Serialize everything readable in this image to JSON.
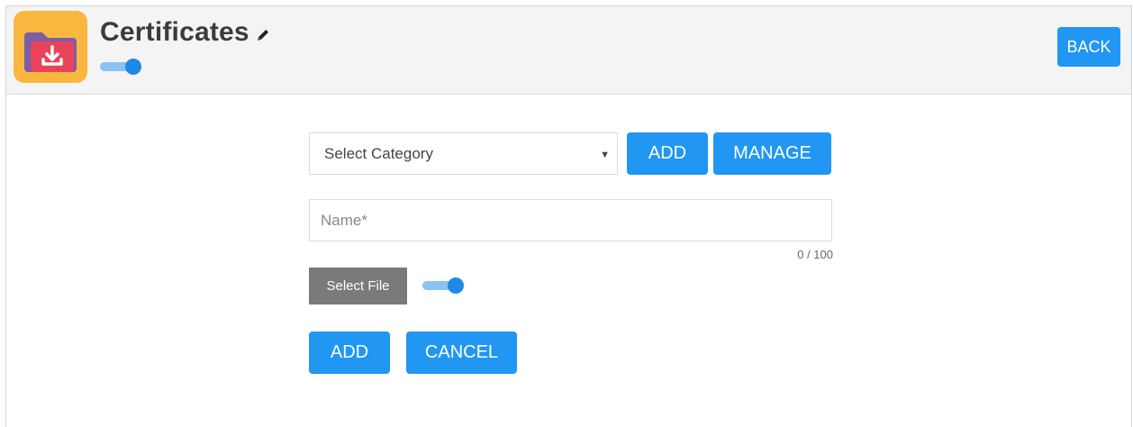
{
  "header": {
    "title": "Certificates",
    "back_label": "BACK",
    "toggle_on": true
  },
  "form": {
    "category": {
      "selected": "Select Category",
      "add_label": "ADD",
      "manage_label": "MANAGE"
    },
    "name": {
      "placeholder": "Name*",
      "value": "",
      "counter": "0 / 100"
    },
    "file": {
      "select_label": "Select File",
      "toggle_on": true
    },
    "actions": {
      "add_label": "ADD",
      "cancel_label": "CANCEL"
    }
  },
  "colors": {
    "primary": "#2196f3",
    "header_bg": "#f4f4f4",
    "icon_bg": "#f9b73f",
    "select_file_bg": "#7a7a7a",
    "toggle_track": "#8cc2f2",
    "toggle_knob": "#1e8ae6"
  },
  "icons": {
    "app": "folder-download-icon",
    "edit": "pencil-icon",
    "dropdown": "caret-down-icon"
  }
}
